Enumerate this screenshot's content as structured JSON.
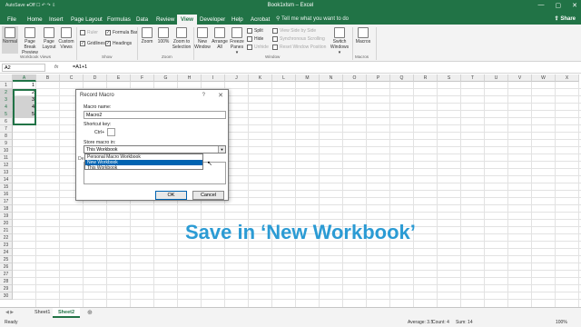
{
  "window": {
    "quick_access": "AutoSave  ●Off  ☐  ↶  ↷  ⇩",
    "title": "Book1xlsm  –  Excel",
    "controls": [
      "—",
      "▢",
      "✕"
    ]
  },
  "tabs": [
    "File",
    "Home",
    "Insert",
    "Page Layout",
    "Formulas",
    "Data",
    "Review",
    "View",
    "Developer",
    "Help",
    "Acrobat"
  ],
  "active_tab": "View",
  "tell_me": "Tell me what you want to do",
  "share": "Share",
  "ribbon": {
    "workbook_views": {
      "normal": "Normal",
      "page_break": "Page Break Preview",
      "page_layout": "Page Layout",
      "custom_views": "Custom Views",
      "label": "Workbook Views"
    },
    "show": {
      "ruler": "Ruler",
      "formula_bar": "Formula Bar",
      "gridlines": "Gridlines",
      "headings": "Headings",
      "label": "Show"
    },
    "zoom": {
      "zoom": "Zoom",
      "hundred": "100%",
      "zoom_sel": "Zoom to Selection",
      "label": "Zoom"
    },
    "window": {
      "new_window": "New Window",
      "arrange_all": "Arrange All",
      "freeze": "Freeze Panes ▾",
      "split": "Split",
      "hide": "Hide",
      "unhide": "Unhide",
      "side_by_side": "View Side by Side",
      "sync_scroll": "Synchronous Scrolling",
      "reset_pos": "Reset Window Position",
      "switch": "Switch Windows ▾",
      "label": "Window"
    },
    "macros": {
      "macros": "Macros",
      "label": "Macros"
    }
  },
  "formula_bar": {
    "name_box": "A2",
    "fx": "fx",
    "formula": "=A1+1"
  },
  "columns": [
    "A",
    "B",
    "C",
    "D",
    "E",
    "F",
    "G",
    "H",
    "I",
    "J",
    "K",
    "L",
    "M",
    "N",
    "O",
    "P",
    "Q",
    "R",
    "S",
    "T",
    "U",
    "V",
    "W",
    "X"
  ],
  "rows": [
    "1",
    "2",
    "3",
    "4",
    "5",
    "6",
    "7",
    "8",
    "9",
    "10",
    "11",
    "12",
    "13",
    "14",
    "15",
    "16",
    "17",
    "18",
    "19",
    "20",
    "21",
    "22",
    "23",
    "24",
    "25",
    "26",
    "27",
    "28",
    "29",
    "30"
  ],
  "cells_a": [
    "1",
    "2",
    "3",
    "4",
    "5"
  ],
  "dialog": {
    "title": "Record Macro",
    "help": "?",
    "close": "✕",
    "macro_name_label": "Macro name:",
    "macro_name": "Macro2",
    "shortcut_label": "Shortcut key:",
    "ctrl": "Ctrl+",
    "store_label": "Store macro in:",
    "store_value": "This Workbook",
    "options": [
      "Personal Macro Workbook",
      "New Workbook",
      "This Workbook"
    ],
    "highlighted": 1,
    "description_label": "De",
    "ok": "OK",
    "cancel": "Cancel"
  },
  "sheets": [
    "Sheet1",
    "Sheet2"
  ],
  "active_sheet": "Sheet2",
  "status": {
    "ready": "Ready",
    "average": "Average: 3.5",
    "count": "Count: 4",
    "sum": "Sum: 14",
    "zoom": "100%"
  },
  "caption": "Save in ‘New Workbook’",
  "colors": {
    "excel_green": "#217346",
    "caption_blue": "#2b9bd4",
    "highlight": "#0063b1"
  }
}
